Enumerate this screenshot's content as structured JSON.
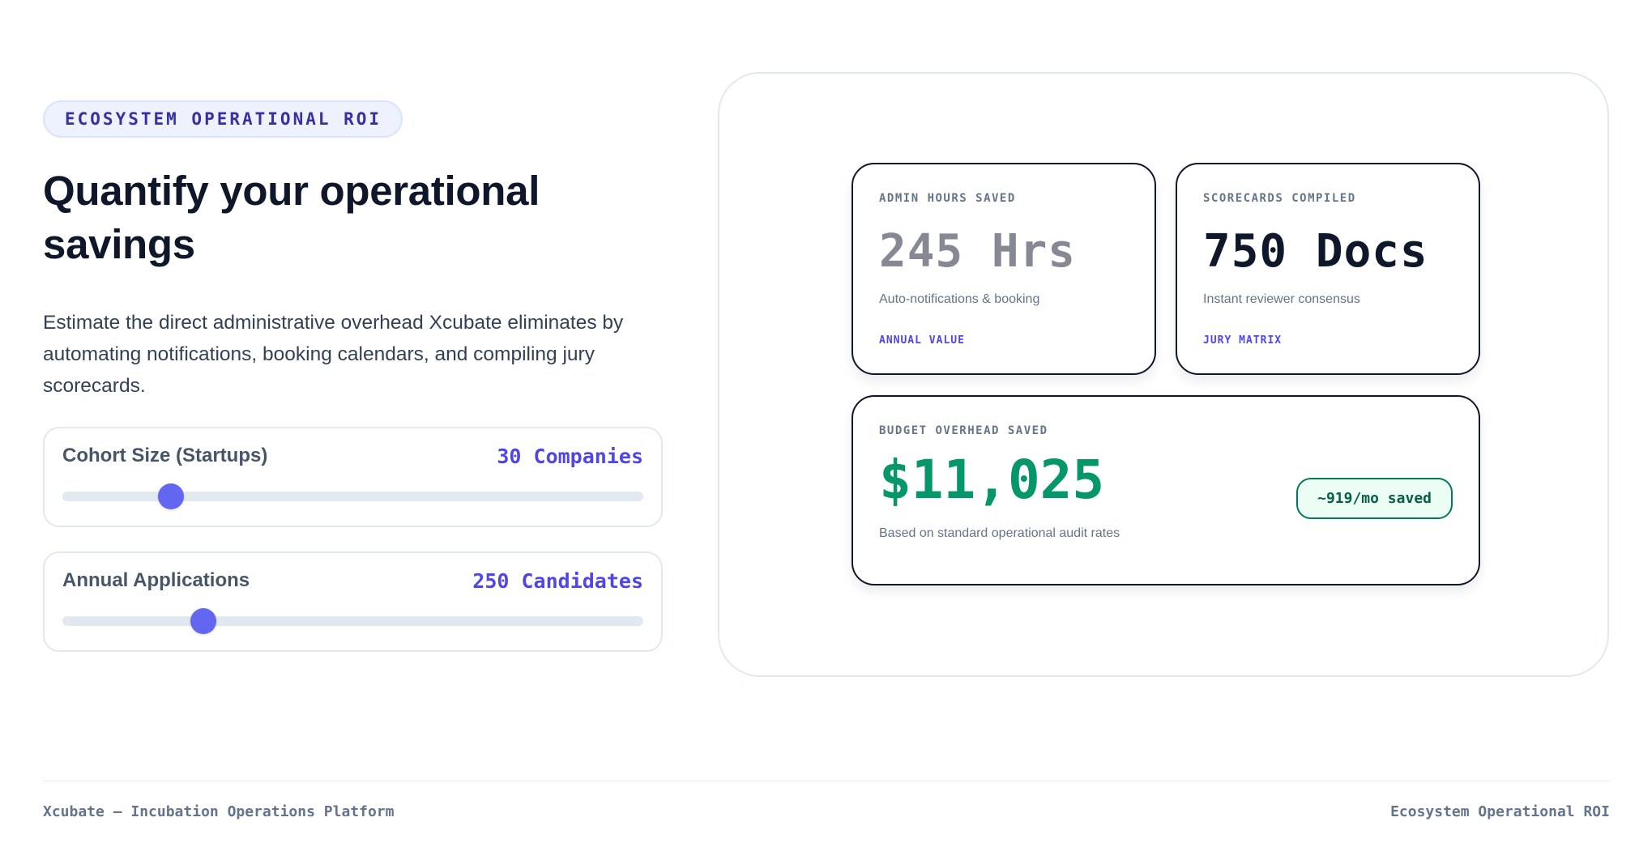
{
  "hero": {
    "eyebrow": "ECOSYSTEM OPERATIONAL ROI",
    "title": "Quantify your operational savings",
    "description": "Estimate the direct administrative overhead Xcubate eliminates by automating notifications, booking calendars, and compiling jury scorecards."
  },
  "sliders": [
    {
      "label": "Cohort Size (Startups)",
      "value_text": "30 Companies",
      "fill_percent": 18.7
    },
    {
      "label": "Annual Applications",
      "value_text": "250 Candidates",
      "fill_percent": 24.2
    }
  ],
  "stats": {
    "admin": {
      "label": "ADMIN HOURS SAVED",
      "value": "245 Hrs",
      "description": "Auto-notifications & booking",
      "foot": "ANNUAL VALUE"
    },
    "scorecards": {
      "label": "SCORECARDS COMPILED",
      "value": "750 Docs",
      "description": "Instant reviewer consensus",
      "foot": "JURY MATRIX"
    },
    "budget": {
      "label": "BUDGET OVERHEAD SAVED",
      "value": "$11,025",
      "description": "Based on standard operational audit rates",
      "monthly": "~919/mo saved"
    }
  },
  "footer": {
    "left": "Xcubate — Incubation Operations Platform",
    "right": "Ecosystem Operational ROI"
  },
  "colors": {
    "accent": "#4f46e5",
    "slider_thumb": "#6366f1",
    "savings_green": "#059669",
    "text_dark": "#0f172a"
  }
}
